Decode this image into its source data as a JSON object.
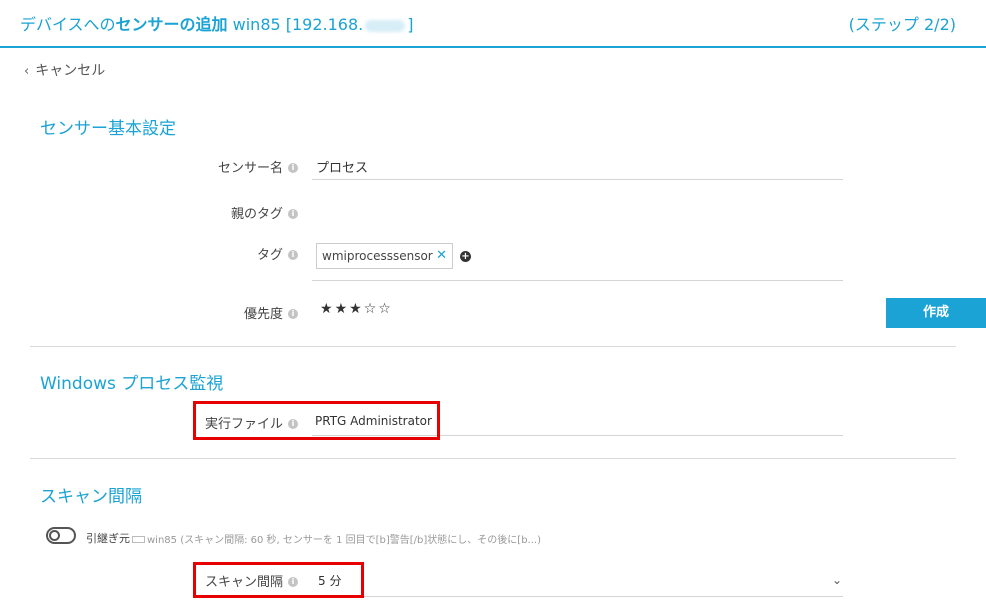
{
  "header": {
    "title_prefix": "デバイスへの",
    "title_bold": "センサーの追加",
    "title_device": "win85 [192.168.",
    "title_suffix": "]",
    "step": "(ステップ 2/2)"
  },
  "nav": {
    "cancel_label": "キャンセル"
  },
  "sections": {
    "basic": {
      "title": "センサー基本設定",
      "sensor_name_label": "センサー名",
      "sensor_name_value": "プロセス",
      "parent_tags_label": "親のタグ",
      "tags_label": "タグ",
      "tag_value": "wmiprocesssensor",
      "priority_label": "優先度",
      "priority": {
        "value": 3,
        "max": 5,
        "filled_char": "★",
        "empty_char": "☆"
      }
    },
    "process": {
      "title": "Windows プロセス監視",
      "executable_label": "実行ファイル",
      "executable_value": "PRTG Administrator"
    },
    "scan": {
      "title": "スキャン間隔",
      "inherit_label": "引継ぎ元",
      "inherit_description": "win85 (スキャン間隔: 60 秒, センサーを 1 回目で[b]警告[/b]状態にし、その後に[b...)",
      "interval_label": "スキャン間隔",
      "interval_value": "5 分"
    }
  },
  "buttons": {
    "create_label": "作成"
  },
  "colors": {
    "accent": "#1aa3d4",
    "highlight": "#e60000"
  }
}
